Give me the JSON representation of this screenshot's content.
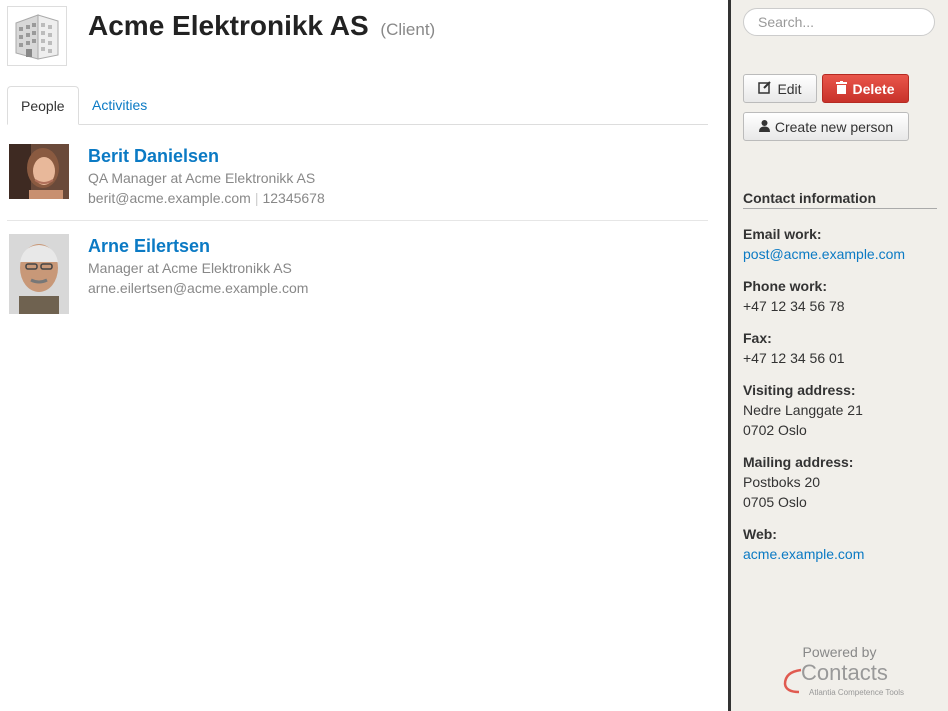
{
  "company": {
    "name": "Acme Elektronikk AS",
    "type": "(Client)"
  },
  "tabs": [
    {
      "label": "People",
      "active": true
    },
    {
      "label": "Activities",
      "active": false
    }
  ],
  "people": [
    {
      "name": "Berit Danielsen",
      "role": "QA Manager at Acme Elektronikk AS",
      "email": "berit@acme.example.com",
      "phone": "12345678"
    },
    {
      "name": "Arne Eilertsen",
      "role": "Manager at Acme Elektronikk AS",
      "email": "arne.eilertsen@acme.example.com"
    }
  ],
  "sidebar": {
    "search_placeholder": "Search...",
    "edit_label": "Edit",
    "delete_label": "Delete",
    "create_label": "Create new person",
    "contact_heading": "Contact information",
    "email_label": "Email work:",
    "email_value": "post@acme.example.com",
    "phone_label": "Phone work:",
    "phone_value": "+47 12 34 56 78",
    "fax_label": "Fax:",
    "fax_value": "+47 12 34 56 01",
    "visiting_label": "Visiting address:",
    "visiting_line1": "Nedre Langgate 21",
    "visiting_line2": "0702 Oslo",
    "mailing_label": "Mailing address:",
    "mailing_line1": "Postboks 20",
    "mailing_line2": "0705 Oslo",
    "web_label": "Web:",
    "web_value": "acme.example.com",
    "powered_by": "Powered by",
    "brand_name": "Contacts",
    "brand_sub": "Atlantia Competence Tools"
  },
  "colors": {
    "link": "#0b7ac4",
    "delete": "#d9443a",
    "sidebar_bg": "#f1efea"
  }
}
